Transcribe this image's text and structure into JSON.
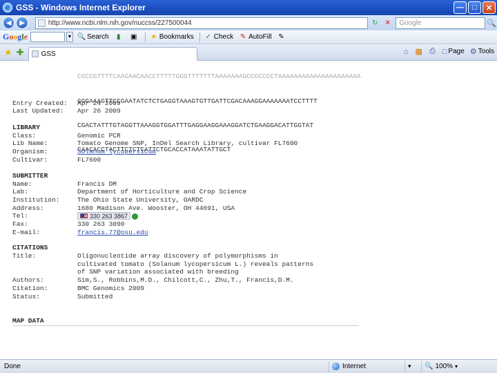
{
  "window": {
    "title": "GSS - Windows Internet Explorer"
  },
  "addressbar": {
    "url": "http://www.ncbi.nlm.nih.gov/nuccss/227500044",
    "search_placeholder": "Google"
  },
  "google_toolbar": {
    "logo": "Google",
    "items": [
      {
        "icon": "search-icon",
        "label": "Search"
      },
      {
        "icon": "pagerank-icon",
        "label": ""
      },
      {
        "icon": "popup-icon",
        "label": ""
      },
      {
        "icon": "star-icon",
        "label": "Bookmarks"
      },
      {
        "icon": "spellcheck-icon",
        "label": "Check"
      },
      {
        "icon": "autofill-icon",
        "label": "AutoFill"
      },
      {
        "icon": "pencil-icon",
        "label": ""
      }
    ]
  },
  "tab": {
    "title": "GSS"
  },
  "tools": [
    {
      "icon": "home-icon",
      "label": ""
    },
    {
      "icon": "feeds-icon",
      "label": ""
    },
    {
      "icon": "print-icon",
      "label": ""
    },
    {
      "icon": "page-icon",
      "label": "Page"
    },
    {
      "icon": "tools-icon",
      "label": "Tools"
    }
  ],
  "record": {
    "sequence_lines": [
      "CGCCGTTTTCAAGAACAACCTTTTTGGGTTTTTTTAAAAAAAGCCGCCCCTAAAAAAAAAAAAAAAAAAAAA",
      "GGGAAAGTTCCGAATATCTCTGAGGTAAAGTGTTGATTCGACAAAGGAAAAAAATCCTTTT",
      "CGACTATTTGTAGGTTAAAGGTGGATTTGAGGAAGGAAAGGATCTGAAGGACATTGGTAT",
      "CAACACCTACTTCTCTCATTCTGCACCATAAATATTGCT"
    ],
    "entry_created_label": "Entry Created:",
    "entry_created": "Apr 24 2009",
    "last_updated_label": "Last Updated:",
    "last_updated": "Apr 26 2009",
    "library_heading": "LIBRARY",
    "lib_class_label": "Class:",
    "lib_class": "Genomic PCR",
    "lib_name_label": "Lib Name:",
    "lib_name": "Tomato Genome SNP, InDel Search Library, cultivar FL7600",
    "organism_label": "Organism:",
    "organism": "Solanum lycopersicum",
    "cultivar_label": "Cultivar:",
    "cultivar": "FL7600",
    "submitter_heading": "SUBMITTER",
    "name_label": "Name:",
    "name": "Francis DM",
    "lab_label": "Lab:",
    "lab": "Department of Horticulture and Crop Science",
    "institution_label": "Institution:",
    "institution": "The Ohio State University, OARDC",
    "address_label": "Address:",
    "address": "1680 Madison Ave. Wooster, OH 44691, USA",
    "tel_label": "Tel:",
    "tel": "330 263 3867",
    "fax_label": "Fax:",
    "fax": "330 263 3090",
    "email_label": "E-mail:",
    "email": "francis.77@osu.edu",
    "citations_heading": "CITATIONS",
    "cit_title_label": "Title:",
    "cit_title_lines": [
      "Oligonucleotide array discovery of polymorphisms in",
      "cultivated tomato (Solanum lycopersicum L.) reveals patterns",
      "of SNP variation associated with breeding"
    ],
    "authors_label": "Authors:",
    "authors": "Sim,S., Robbins,M.D., Chilcott,C., Zhu,T., Francis,D.M.",
    "citation_label": "Citation:",
    "citation": "BMC Genomics 2009",
    "status_label": "Status:",
    "status": "Submitted",
    "map_heading": "MAP DATA"
  },
  "statusbar": {
    "left": "Done",
    "zone": "Internet",
    "zoom": "100%"
  }
}
